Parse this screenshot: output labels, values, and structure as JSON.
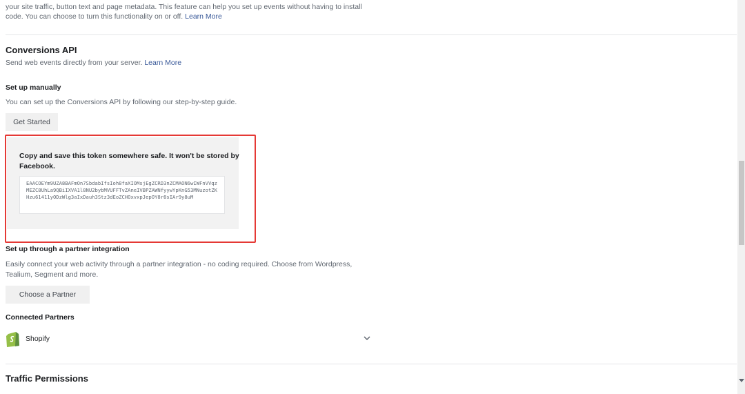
{
  "top_text": {
    "line1": "your site traffic, button text and page metadata. This feature can help you set up events without having to install",
    "line2_prefix": "code. You can choose to turn this functionality on or off.",
    "learn_more": "Learn More"
  },
  "conversions_api": {
    "title": "Conversions API",
    "desc_prefix": "Send web events directly from your server.",
    "learn_more": "Learn More"
  },
  "manual": {
    "heading": "Set up manually",
    "desc": "You can set up the Conversions API by following our step-by-step guide.",
    "button": "Get Started"
  },
  "token": {
    "notice_line1": "Copy and save this token somewhere safe. It won't be stored by",
    "notice_line2": "Facebook.",
    "value": "EAACOEYm9UZA8BAFmOn7SbdabIfsIoh8faXIOMsjEgZCRD3nZCMAON6wIWFnVVqzMEZC8UhLa9QBiIXVA1l8NU2bybMVUFFTvZAneIVBPZAWNfyywYpKnG53MNuzotZKHzu61411yODzWlg3aIxDauh3Stz3dEoZCHOxvxpJepOY8r8sIAr9y8uM"
  },
  "partner": {
    "heading": "Set up through a partner integration",
    "desc_line1": "Easily connect your web activity through a partner integration - no coding required. Choose from Wordpress,",
    "desc_line2": "Tealium, Segment and more.",
    "button": "Choose a Partner"
  },
  "connected": {
    "heading": "Connected Partners",
    "items": [
      {
        "name": "Shopify",
        "icon": "shopify-icon"
      }
    ]
  },
  "traffic": {
    "title": "Traffic Permissions"
  },
  "colors": {
    "link": "#385898",
    "highlight": "#e53935",
    "shopify": "#95bf47"
  }
}
